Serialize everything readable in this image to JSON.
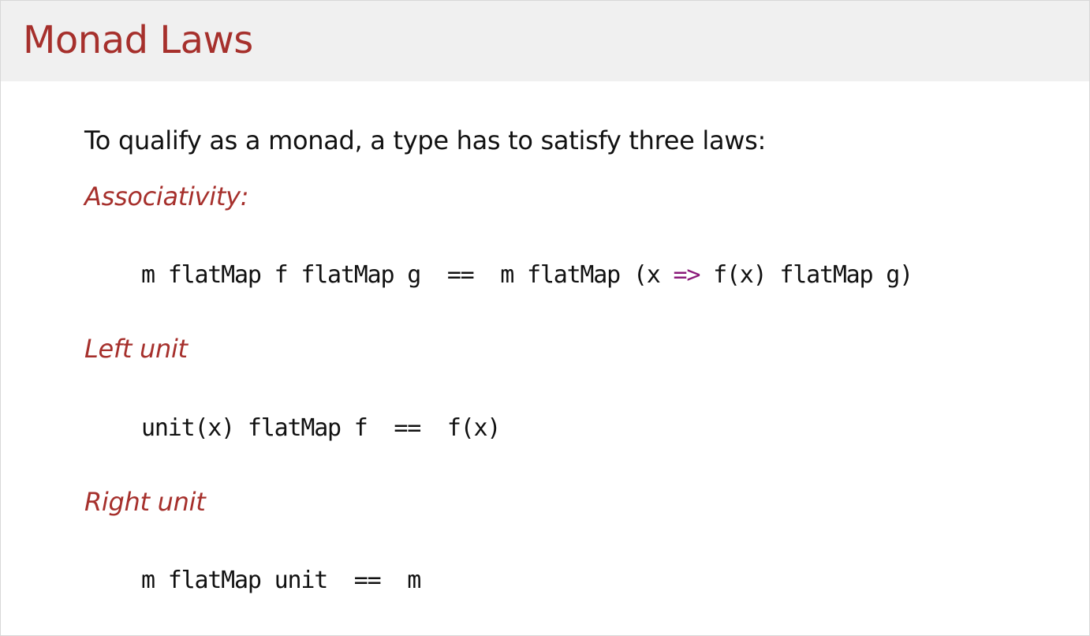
{
  "slide": {
    "title": "Monad Laws",
    "intro": "To qualify as a monad, a type has to satisfy three laws:",
    "laws": [
      {
        "heading": "Associativity:",
        "code_before_arrow": "m flatMap f flatMap g  ==  m flatMap (x ",
        "code_arrow": "=>",
        "code_after_arrow": " f(x) flatMap g)"
      },
      {
        "heading": "Left unit",
        "code": "unit(x) flatMap f  ==  f(x)"
      },
      {
        "heading": "Right unit",
        "code": "m flatMap unit  ==  m"
      }
    ]
  },
  "colors": {
    "title_accent": "#a6302c",
    "title_bar_background": "#f0f0f0",
    "arrow_keyword": "#8b1a7a",
    "body_text": "#111111"
  }
}
